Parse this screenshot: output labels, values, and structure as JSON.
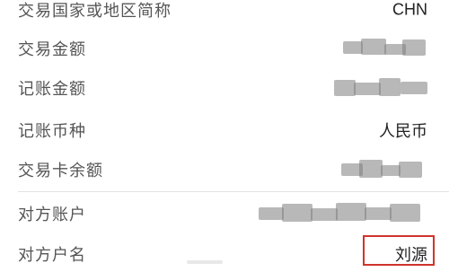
{
  "rows": [
    {
      "label": "交易国家或地区简称",
      "value": "CHN"
    },
    {
      "label": "交易金额",
      "value": ""
    },
    {
      "label": "记账金额",
      "value": ""
    },
    {
      "label": "记账币种",
      "value": "人民币"
    },
    {
      "label": "交易卡余额",
      "value": ""
    },
    {
      "label": "对方账户",
      "value": ""
    },
    {
      "label": "对方户名",
      "value": "刘源"
    }
  ],
  "colors": {
    "label_text": "#555555",
    "value_text": "#222222",
    "highlight_border": "#d0342c",
    "divider": "#e3e3e3"
  }
}
